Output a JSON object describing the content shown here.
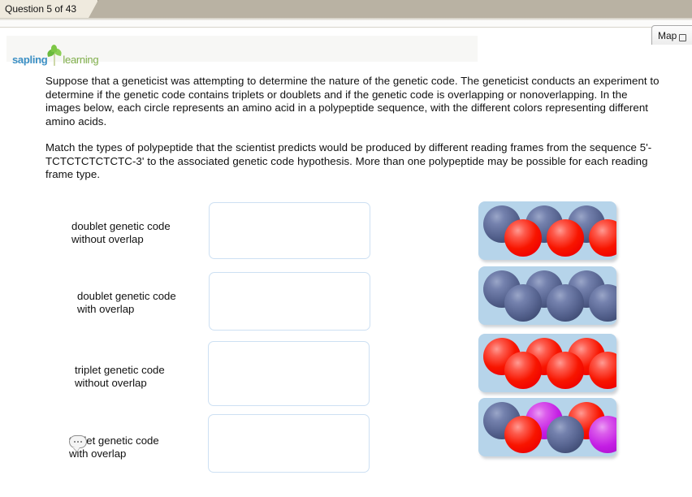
{
  "browser": {
    "tab_label": "Question 5 of 43",
    "map_button_label": "Map",
    "map_icon": "map-pin-icon"
  },
  "branding": {
    "logo_first": "sapling",
    "logo_second": "learning",
    "logo_icon": "sapling-plant-icon",
    "color_blue": "#3b8fc4",
    "color_green": "#7fae4a"
  },
  "question": {
    "paragraph1": "Suppose that a geneticist was attempting to determine the nature of the genetic code. The geneticist conducts an experiment to determine if the genetic code contains triplets or doublets and if the genetic code is overlapping or nonoverlapping. In the images below, each circle represents an amino acid in a polypeptide sequence, with the different colors representing different amino acids.",
    "paragraph2": "Match the types of polypeptide that the scientist predicts would be produced by different reading frames from the sequence 5'-TCTCTCTCTCTC-3' to the associated genetic code hypothesis. More than one polypeptide may be possible for each reading frame type."
  },
  "match_rows": [
    {
      "label_line1": "doublet genetic code",
      "label_line2": "without overlap",
      "dropzone_name": "dropzone-doublet-without-overlap",
      "dropzone_value": ""
    },
    {
      "label_line1": "doublet genetic code",
      "label_line2": "with overlap",
      "dropzone_name": "dropzone-doublet-with-overlap",
      "dropzone_value": ""
    },
    {
      "label_line1": "triplet genetic code",
      "label_line2": "without overlap",
      "dropzone_name": "dropzone-triplet-without-overlap",
      "dropzone_value": ""
    },
    {
      "label_line1": "triplet genetic code",
      "label_line2": "with overlap",
      "dropzone_name": "dropzone-triplet-with-overlap",
      "dropzone_value": "",
      "has_comment_icon": true
    }
  ],
  "comment_icon": {
    "name": "comment-bubble-icon",
    "glyph": "..."
  },
  "colors": {
    "amino_blue": "#56638f",
    "amino_red": "#f81500",
    "amino_magenta": "#c41ee4",
    "panel_background": "#b6d4ea",
    "dropbox_border": "#cde0f3",
    "tab_background": "#efeade",
    "tabstrip_background": "#b9b2a3"
  },
  "polypeptide_tiles": [
    {
      "name": "polypeptide-tile-1",
      "description": "alternating blue and red amino acids",
      "spheres": [
        {
          "color": "blue",
          "row": "top"
        },
        {
          "color": "red",
          "row": "bottom"
        },
        {
          "color": "blue",
          "row": "top"
        },
        {
          "color": "red",
          "row": "bottom"
        },
        {
          "color": "blue",
          "row": "top"
        },
        {
          "color": "red",
          "row": "bottom"
        }
      ]
    },
    {
      "name": "polypeptide-tile-2",
      "description": "all blue amino acids",
      "spheres": [
        {
          "color": "blue",
          "row": "top"
        },
        {
          "color": "blue",
          "row": "bottom"
        },
        {
          "color": "blue",
          "row": "top"
        },
        {
          "color": "blue",
          "row": "bottom"
        },
        {
          "color": "blue",
          "row": "top"
        },
        {
          "color": "blue",
          "row": "bottom"
        }
      ]
    },
    {
      "name": "polypeptide-tile-3",
      "description": "all red amino acids",
      "spheres": [
        {
          "color": "red",
          "row": "top"
        },
        {
          "color": "red",
          "row": "bottom"
        },
        {
          "color": "red",
          "row": "top"
        },
        {
          "color": "red",
          "row": "bottom"
        },
        {
          "color": "red",
          "row": "top"
        },
        {
          "color": "red",
          "row": "bottom"
        }
      ]
    },
    {
      "name": "polypeptide-tile-4",
      "description": "repeating blue red magenta amino acids",
      "spheres": [
        {
          "color": "blue",
          "row": "top"
        },
        {
          "color": "red",
          "row": "bottom"
        },
        {
          "color": "magenta",
          "row": "top"
        },
        {
          "color": "blue",
          "row": "bottom"
        },
        {
          "color": "red",
          "row": "top"
        },
        {
          "color": "magenta",
          "row": "bottom"
        }
      ]
    }
  ]
}
